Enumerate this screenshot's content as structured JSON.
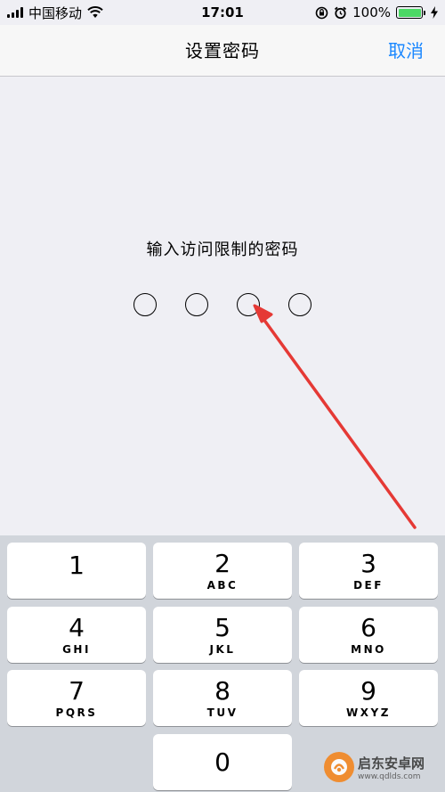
{
  "status_bar": {
    "carrier": "中国移动",
    "time": "17:01",
    "battery_percent": "100%",
    "battery_level": 1.0,
    "icons": [
      "signal-icon",
      "wifi-icon",
      "rotation-lock-icon",
      "alarm-icon",
      "battery-icon",
      "charging-icon"
    ]
  },
  "nav": {
    "title": "设置密码",
    "cancel_label": "取消"
  },
  "prompt": "输入访问限制的密码",
  "passcode": {
    "length": 4,
    "entered": 0
  },
  "keypad": {
    "keys": [
      {
        "digit": "1",
        "letters": ""
      },
      {
        "digit": "2",
        "letters": "ABC"
      },
      {
        "digit": "3",
        "letters": "DEF"
      },
      {
        "digit": "4",
        "letters": "GHI"
      },
      {
        "digit": "5",
        "letters": "JKL"
      },
      {
        "digit": "6",
        "letters": "MNO"
      },
      {
        "digit": "7",
        "letters": "PQRS"
      },
      {
        "digit": "8",
        "letters": "TUV"
      },
      {
        "digit": "9",
        "letters": "WXYZ"
      },
      {
        "digit": "0",
        "letters": ""
      }
    ]
  },
  "watermark": {
    "name": "启东安卓网",
    "url": "www.qdlds.com"
  },
  "colors": {
    "accent": "#1a87ff",
    "annotation_arrow": "#e53935",
    "battery": "#4cd964"
  }
}
